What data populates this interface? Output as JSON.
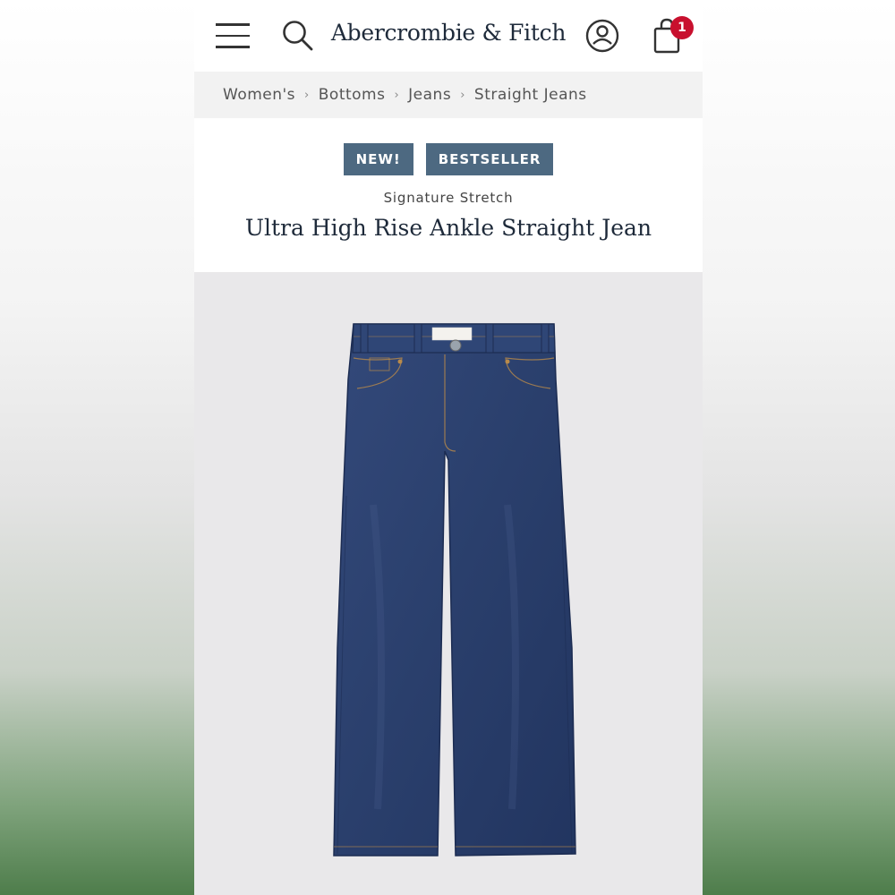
{
  "header": {
    "menu_icon": "hamburger-menu-icon",
    "search_icon": "search-icon",
    "logo": "Abercrombie & Fitch",
    "account_icon": "account-icon",
    "bag_icon": "shopping-bag-icon",
    "bag_count": "1"
  },
  "breadcrumb": {
    "items": [
      "Women's",
      "Bottoms",
      "Jeans",
      "Straight Jeans"
    ]
  },
  "product": {
    "tags": [
      "NEW!",
      "BESTSELLER"
    ],
    "subtitle": "Signature Stretch",
    "name": "Ultra High Rise Ankle Straight Jean",
    "image": "dark-wash-straight-jeans-image"
  },
  "colors": {
    "tag_bg": "#4d6981",
    "badge": "#c8102e",
    "denim": "#2c4270",
    "breadcrumb_bg": "#f2f2f2",
    "image_bg": "#e9e8ea"
  }
}
